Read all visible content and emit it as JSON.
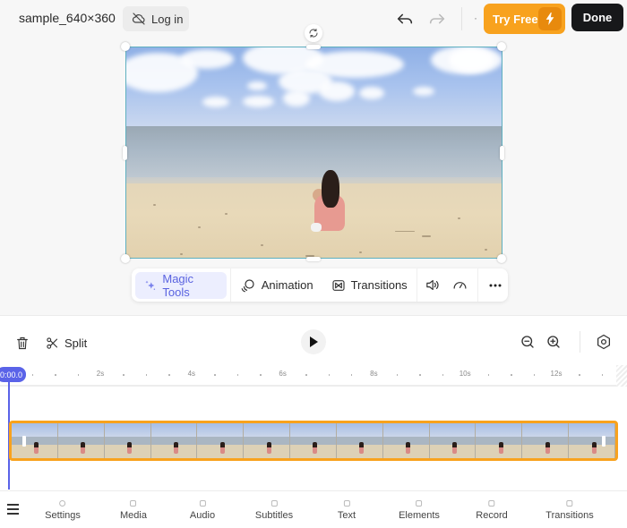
{
  "header": {
    "filename": "sample_640×360",
    "login_label": "Log in",
    "try_free_label": "Try Free",
    "done_label": "Done",
    "separator_dot": "·"
  },
  "toolbar": {
    "magic_tools_label": "Magic Tools",
    "animation_label": "Animation",
    "transitions_label": "Transitions"
  },
  "timeline": {
    "split_label": "Split",
    "playhead_time": "0:00.0",
    "ruler_labels": [
      "2s",
      "4s",
      "6s",
      "8s",
      "10s",
      "12s"
    ],
    "clip_frame_count": 13
  },
  "bottom_nav": {
    "items": [
      {
        "label": "Settings"
      },
      {
        "label": "Media"
      },
      {
        "label": "Audio"
      },
      {
        "label": "Subtitles"
      },
      {
        "label": "Text"
      },
      {
        "label": "Elements"
      },
      {
        "label": "Record"
      },
      {
        "label": "Transitions"
      }
    ]
  },
  "colors": {
    "accent": "#5a63e8",
    "try_free": "#f8a21e",
    "clip_border": "#f8a21e",
    "done": "#17181a"
  }
}
